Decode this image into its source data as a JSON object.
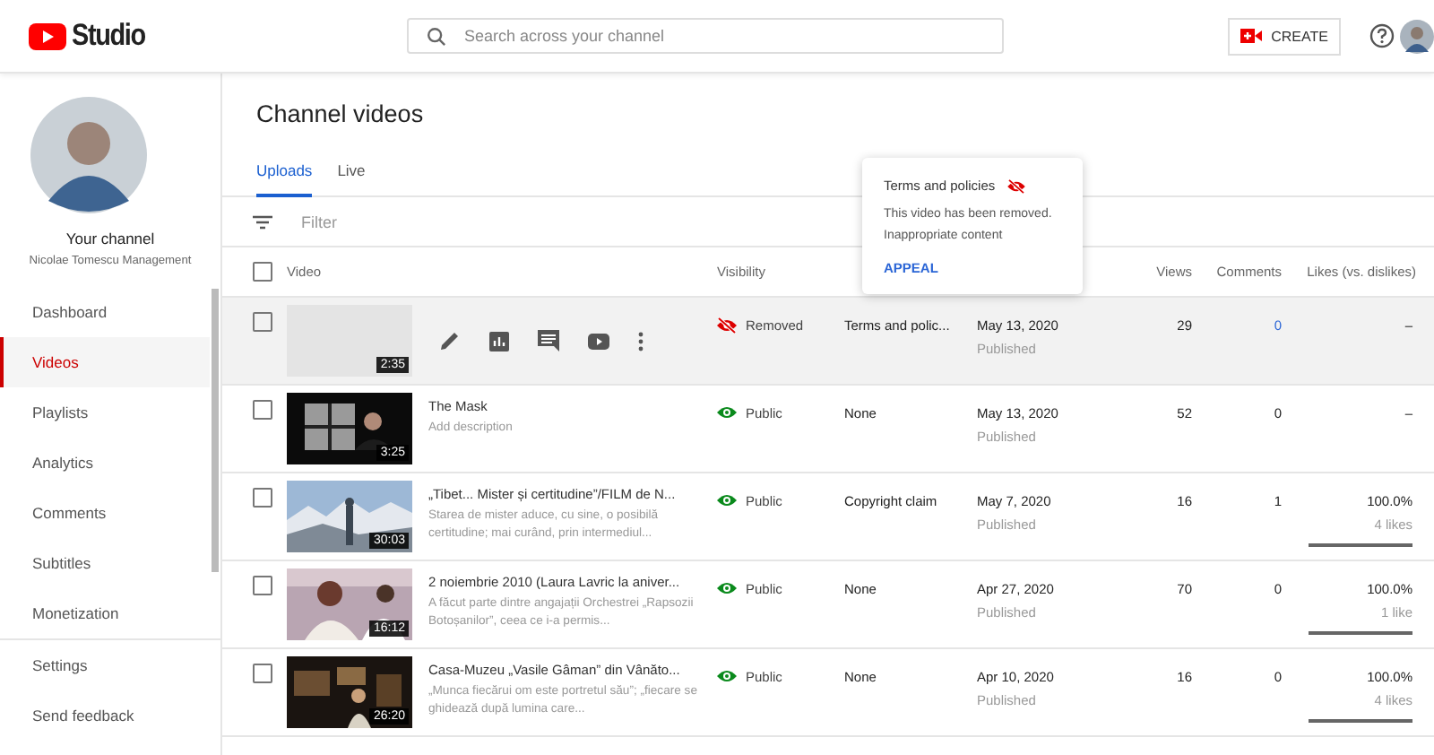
{
  "header": {
    "logo": "Studio",
    "search": {
      "placeholder": "Search across your channel"
    },
    "create_button": "CREATE"
  },
  "sidebar": {
    "channel_label": "Your channel",
    "channel_name": "Nicolae Tomescu Management",
    "items": [
      {
        "label": "Dashboard",
        "selected": false
      },
      {
        "label": "Videos",
        "selected": true
      },
      {
        "label": "Playlists",
        "selected": false
      },
      {
        "label": "Analytics",
        "selected": false
      },
      {
        "label": "Comments",
        "selected": false
      },
      {
        "label": "Subtitles",
        "selected": false
      },
      {
        "label": "Monetization",
        "selected": false
      }
    ],
    "footer_items": [
      {
        "label": "Settings"
      },
      {
        "label": "Send feedback"
      }
    ]
  },
  "page_title": "Channel videos",
  "tabs": [
    {
      "label": "Uploads",
      "selected": true
    },
    {
      "label": "Live",
      "selected": false
    }
  ],
  "filter": {
    "placeholder": "Filter"
  },
  "table": {
    "select_all_checked": false,
    "columns": [
      "Video",
      "Visibility",
      "",
      "",
      "Views",
      "Comments",
      "Likes (vs. dislikes)"
    ],
    "rows": [
      {
        "checked": false,
        "thumbnail": {
          "kind": "blank"
        },
        "duration": "2:35",
        "hovered": true,
        "visibility": {
          "kind": "removed",
          "label": "Removed"
        },
        "restrictions": "Terms and polic...",
        "date": "May 13, 2020",
        "date_status": "Published",
        "views": "29",
        "comments": "0",
        "likes": "–"
      },
      {
        "checked": false,
        "duration": "3:25",
        "hovered": false,
        "title": "The Mask",
        "description": "Add description",
        "visibility": {
          "kind": "public",
          "label": "Public"
        },
        "restrictions": "None",
        "date": "May 13, 2020",
        "date_status": "Published",
        "views": "52",
        "comments": "0",
        "likes": "–"
      },
      {
        "checked": false,
        "duration": "30:03",
        "hovered": false,
        "title": "„Tibet... Mister și certitudine”/FILM de N...",
        "description": "Starea de mister aduce, cu sine, o posibilă certitudine; mai curând, prin intermediul...",
        "visibility": {
          "kind": "public",
          "label": "Public"
        },
        "restrictions": "Copyright claim",
        "date": "May 7, 2020",
        "date_status": "Published",
        "views": "16",
        "comments": "1",
        "likes": "100.0%",
        "likes_count": "4 likes",
        "level": 1
      },
      {
        "checked": false,
        "duration": "16:12",
        "hovered": false,
        "title": "2 noiembrie 2010 (Laura Lavric la aniver...",
        "description": "A făcut parte dintre angajații Orchestrei „Rapsozii Botoșanilor”, ceea ce i-a permis...",
        "visibility": {
          "kind": "public",
          "label": "Public"
        },
        "restrictions": "None",
        "date": "Apr 27, 2020",
        "date_status": "Published",
        "views": "70",
        "comments": "0",
        "likes": "100.0%",
        "likes_count": "1 like",
        "level": 1
      },
      {
        "checked": false,
        "duration": "26:20",
        "hovered": false,
        "title": "Casa-Muzeu „Vasile Gâman” din Vânăto...",
        "description": "„Munca fiecărui om este portretul său”; „fiecare se ghidează după lumina care...",
        "visibility": {
          "kind": "public",
          "label": "Public"
        },
        "restrictions": "None",
        "date": "Apr 10, 2020",
        "date_status": "Published",
        "views": "16",
        "comments": "0",
        "likes": "100.0%",
        "likes_count": "4 likes",
        "level": 1
      }
    ]
  },
  "popup": {
    "title": "Terms and policies",
    "text": "This video has been removed.",
    "reason": "Inappropriate content",
    "action": "APPEAL"
  }
}
